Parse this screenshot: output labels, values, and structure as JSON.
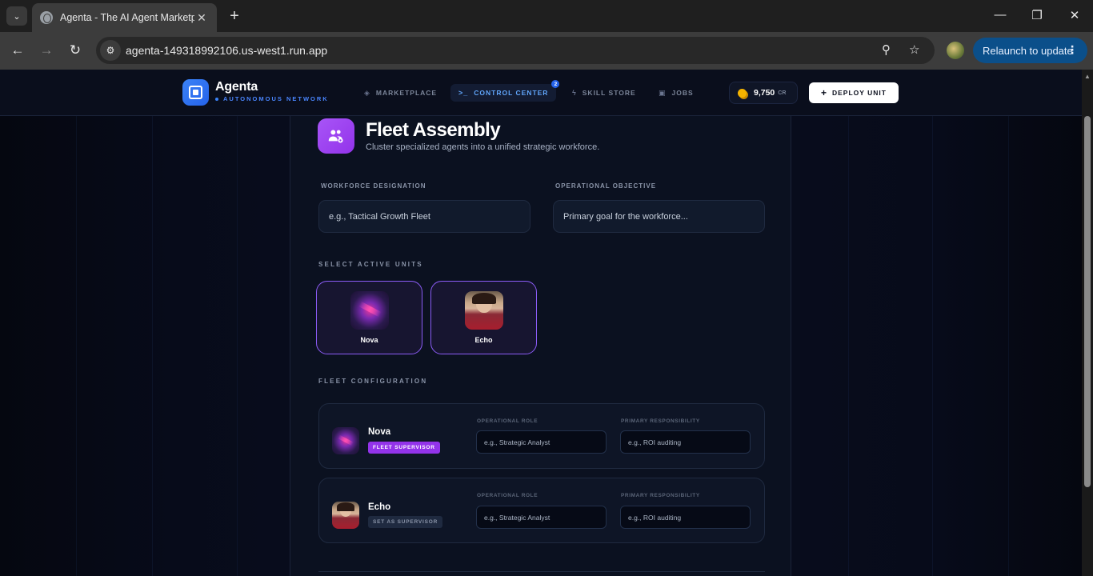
{
  "browser": {
    "tab_title": "Agenta - The AI Agent Marketplace",
    "url": "agenta-149318992106.us-west1.run.app",
    "relaunch_label": "Relaunch to update"
  },
  "header": {
    "brand": "Agenta",
    "brand_sub": "AUTONOMOUS NETWORK",
    "nav": [
      {
        "label": "MARKETPLACE",
        "icon": "layers-icon"
      },
      {
        "label": "CONTROL CENTER",
        "icon": "terminal-icon",
        "badge": "2",
        "active": true
      },
      {
        "label": "SKILL STORE",
        "icon": "bolt-icon"
      },
      {
        "label": "JOBS",
        "icon": "briefcase-icon"
      }
    ],
    "credits": "9,750",
    "credits_unit": "CR",
    "deploy_label": "DEPLOY UNIT"
  },
  "panel": {
    "title": "Fleet Assembly",
    "subtitle": "Cluster specialized agents into a unified strategic workforce.",
    "designation_label": "WORKFORCE DESIGNATION",
    "designation_placeholder": "e.g., Tactical Growth Fleet",
    "objective_label": "OPERATIONAL OBJECTIVE",
    "objective_placeholder": "Primary goal for the workforce...",
    "select_units_label": "SELECT ACTIVE UNITS",
    "units": [
      {
        "name": "Nova"
      },
      {
        "name": "Echo"
      }
    ],
    "config_label": "FLEET CONFIGURATION",
    "config": [
      {
        "name": "Nova",
        "badge": "FLEET SUPERVISOR",
        "supervisor": true,
        "role_label": "OPERATIONAL ROLE",
        "role_placeholder": "e.g., Strategic Analyst",
        "resp_label": "PRIMARY RESPONSIBILITY",
        "resp_placeholder": "e.g., ROI auditing"
      },
      {
        "name": "Echo",
        "badge": "SET AS SUPERVISOR",
        "supervisor": false,
        "role_label": "OPERATIONAL ROLE",
        "role_placeholder": "e.g., Strategic Analyst",
        "resp_label": "PRIMARY RESPONSIBILITY",
        "resp_placeholder": "e.g., ROI auditing"
      }
    ]
  },
  "colors": {
    "accent_blue": "#3b82f6",
    "accent_purple": "#9333ea",
    "background": "#060814"
  }
}
